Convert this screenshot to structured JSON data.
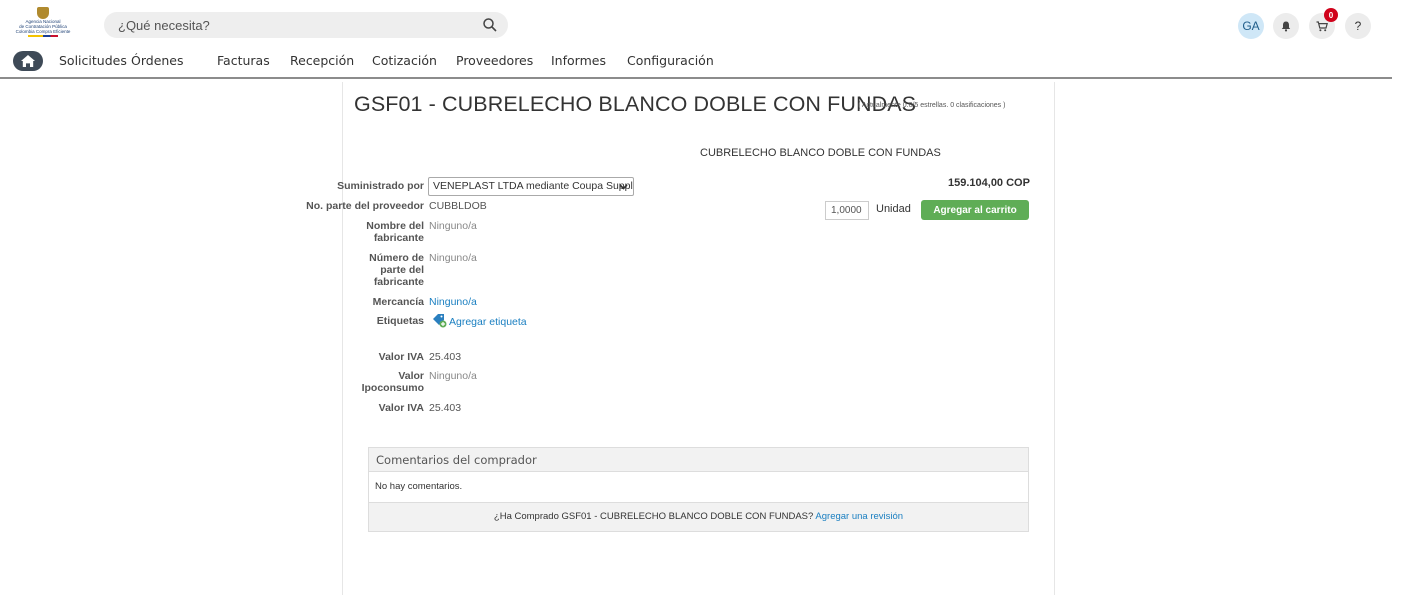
{
  "header": {
    "logo": {
      "line1": "Agencia Nacional",
      "line2": "de Contratación Pública",
      "line3": "Colombia Compra Eficiente"
    },
    "search": {
      "placeholder": "¿Qué necesita?",
      "icon": "search-icon"
    },
    "user_initials": "GA",
    "notifications_icon": "bell-icon",
    "cart_icon": "cart-icon",
    "cart_count": "0",
    "help_label": "?"
  },
  "nav": {
    "home_icon": "home-icon",
    "items": [
      "Solicitudes",
      "Órdenes",
      "Facturas",
      "Recepción",
      "Cotización",
      "Proveedores",
      "Informes",
      "Configuración"
    ]
  },
  "product": {
    "title": "GSF01 - CUBRELECHO BLANCO DOBLE CON FUNDAS",
    "rating": "( Actualmente 0.0/5 estrellas. 0 clasificaciones )",
    "description": "CUBRELECHO BLANCO DOBLE CON FUNDAS",
    "price": "159.104,00 COP",
    "quantity": "1,0000",
    "unit": "Unidad",
    "add_to_cart": "Agregar al carrito",
    "supplied_by_label": "Suministrado por",
    "supplied_by_value": "VENEPLAST LTDA mediante Coupa Suppli",
    "fields": {
      "part_no_label": "No. parte del proveedor",
      "part_no_value": "CUBBLDOB",
      "manufacturer_label": "Nombre del fabricante",
      "manufacturer_value": "Ninguno/a",
      "mfr_part_label": "Número de parte del fabricante",
      "mfr_part_value": "Ninguno/a",
      "commodity_label": "Mercancía",
      "commodity_value": "Ninguno/a",
      "tags_label": "Etiquetas",
      "tags_value": "Agregar etiqueta",
      "iva_label": "Valor IVA",
      "iva_value": "25.403",
      "ipoconsumo_label": "Valor Ipoconsumo",
      "ipoconsumo_value": "Ninguno/a",
      "iva2_label": "Valor IVA",
      "iva2_value": "25.403"
    }
  },
  "comments": {
    "header": "Comentarios del comprador",
    "empty": "No hay comentarios.",
    "question": "¿Ha Comprado GSF01 - CUBRELECHO BLANCO DOBLE CON FUNDAS?",
    "review_link": "Agregar una revisión"
  },
  "colors": {
    "accent_green": "#5fad56",
    "link_blue": "#1a7fc1",
    "badge_red": "#d0021b"
  }
}
